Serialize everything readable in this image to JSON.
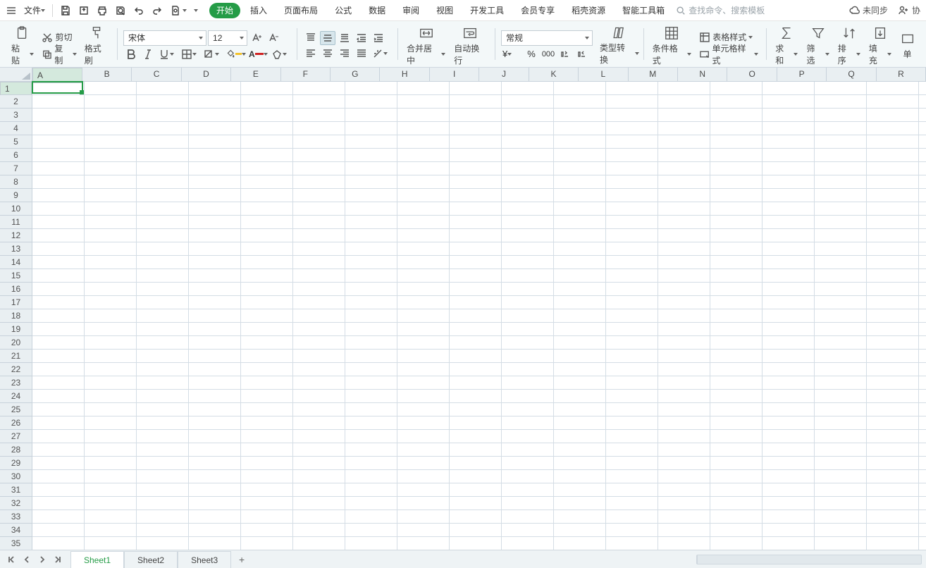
{
  "topbar": {
    "file_label": "文件",
    "menu": [
      "开始",
      "插入",
      "页面布局",
      "公式",
      "数据",
      "审阅",
      "视图",
      "开发工具",
      "会员专享",
      "稻壳资源",
      "智能工具箱"
    ],
    "menu_active_index": 0,
    "search_placeholder": "查找命令、搜索模板",
    "sync_label": "未同步",
    "coop_label": "协"
  },
  "ribbon": {
    "paste": "粘贴",
    "cut": "剪切",
    "copy": "复制",
    "format_painter": "格式刷",
    "font_name": "宋体",
    "font_size": "12",
    "merge_center": "合并居中",
    "auto_wrap": "自动换行",
    "number_format": "常规",
    "type_convert": "类型转换",
    "cond_format": "条件格式",
    "table_style": "表格样式",
    "cell_style": "单元格样式",
    "sum": "求和",
    "filter": "筛选",
    "sort": "排序",
    "fill": "填充",
    "cell": "单"
  },
  "grid": {
    "columns": [
      "A",
      "B",
      "C",
      "D",
      "E",
      "F",
      "G",
      "H",
      "I",
      "J",
      "K",
      "L",
      "M",
      "N",
      "O",
      "P",
      "Q",
      "R"
    ],
    "rows": [
      "1",
      "2",
      "3",
      "4",
      "5",
      "6",
      "7",
      "8",
      "9",
      "10",
      "11",
      "12",
      "13",
      "14",
      "15",
      "16",
      "17",
      "18",
      "19",
      "20",
      "21",
      "22",
      "23",
      "24",
      "25",
      "26",
      "27",
      "28",
      "29",
      "30",
      "31",
      "32",
      "33",
      "34",
      "35"
    ],
    "selected_col_index": 0,
    "selected_row_index": 0
  },
  "sheets": {
    "tabs": [
      "Sheet1",
      "Sheet2",
      "Sheet3"
    ],
    "active_index": 0,
    "add_label": "+"
  }
}
